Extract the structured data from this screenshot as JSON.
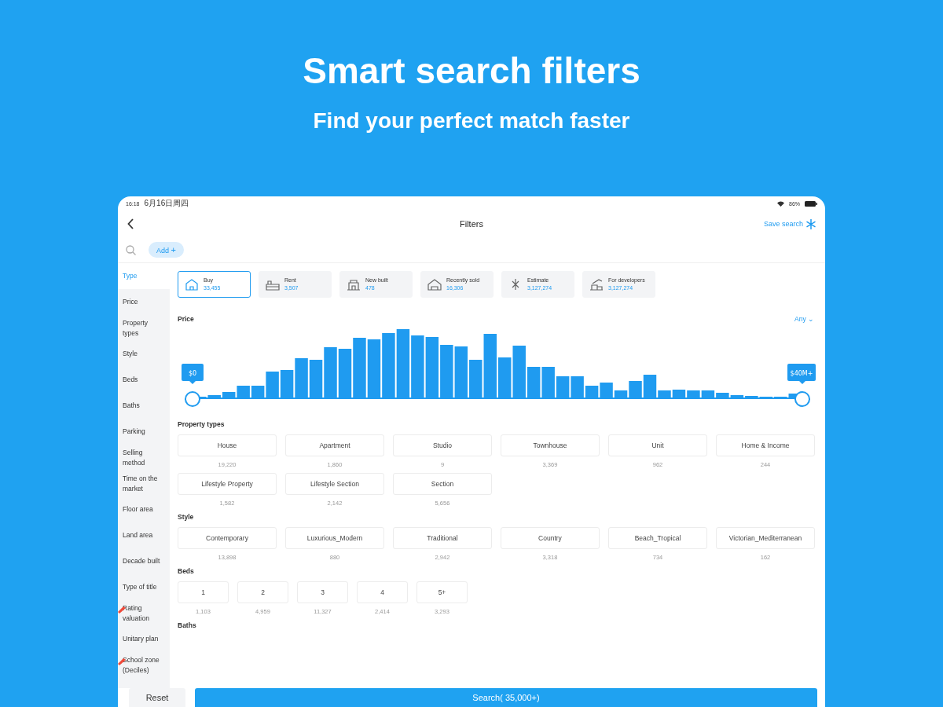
{
  "headline": "Smart search filters",
  "subheadline": "Find your perfect match faster",
  "status_bar": {
    "time": "16:18",
    "date": "6月16日周四",
    "battery": "86%"
  },
  "nav": {
    "title": "Filters",
    "save": "Save search"
  },
  "search": {
    "chip": "Add",
    "chip_icon": "+"
  },
  "sidebar": [
    {
      "label": "Type",
      "selected": true,
      "marked": false
    },
    {
      "label": "Price",
      "selected": false,
      "marked": false
    },
    {
      "label": "Property types",
      "selected": false,
      "marked": false
    },
    {
      "label": "Style",
      "selected": false,
      "marked": false
    },
    {
      "label": "Beds",
      "selected": false,
      "marked": false
    },
    {
      "label": "Baths",
      "selected": false,
      "marked": false
    },
    {
      "label": "Parking",
      "selected": false,
      "marked": false
    },
    {
      "label": "Selling method",
      "selected": false,
      "marked": false
    },
    {
      "label": "Time on the market",
      "selected": false,
      "marked": false
    },
    {
      "label": "Floor area",
      "selected": false,
      "marked": false
    },
    {
      "label": "Land area",
      "selected": false,
      "marked": false
    },
    {
      "label": "Decade built",
      "selected": false,
      "marked": false
    },
    {
      "label": "Type of title",
      "selected": false,
      "marked": false
    },
    {
      "label": "Rating valuation",
      "selected": false,
      "marked": true
    },
    {
      "label": "Unitary plan",
      "selected": false,
      "marked": false
    },
    {
      "label": "School zone (Deciles)",
      "selected": false,
      "marked": true
    }
  ],
  "types": [
    {
      "kind": "buy",
      "label": "Buy",
      "count": "33,455",
      "selected": true
    },
    {
      "kind": "rent",
      "label": "Rent",
      "count": "3,507",
      "selected": false
    },
    {
      "kind": "new",
      "label": "New built",
      "count": "478",
      "selected": false
    },
    {
      "kind": "sold",
      "label": "Recently sold",
      "count": "16,306",
      "selected": false
    },
    {
      "kind": "estimate",
      "label": "Estimate",
      "count": "3,127,274",
      "selected": false
    },
    {
      "kind": "developers",
      "label": "For developers",
      "count": "3,127,274",
      "selected": false
    }
  ],
  "price": {
    "label": "Price",
    "any": "Any",
    "any_icon": "⌄",
    "min": "$0",
    "max": "$40M+"
  },
  "sections": [
    {
      "title": "Property types",
      "kind": "wide",
      "options": [
        {
          "label": "House",
          "count": "19,220"
        },
        {
          "label": "Apartment",
          "count": "1,860"
        },
        {
          "label": "Studio",
          "count": "9"
        },
        {
          "label": "Townhouse",
          "count": "3,369"
        },
        {
          "label": "Unit",
          "count": "962"
        },
        {
          "label": "Home & Income",
          "count": "244"
        },
        {
          "label": "Lifestyle Property",
          "count": "1,582"
        },
        {
          "label": "Lifestyle Section",
          "count": "2,142"
        },
        {
          "label": "Section",
          "count": "5,656"
        }
      ]
    },
    {
      "title": "Style",
      "kind": "wide",
      "options": [
        {
          "label": "Contemporary",
          "count": "13,898"
        },
        {
          "label": "Luxurious_Modern",
          "count": "880"
        },
        {
          "label": "Traditional",
          "count": "2,942"
        },
        {
          "label": "Country",
          "count": "3,318"
        },
        {
          "label": "Beach_Tropical",
          "count": "734"
        },
        {
          "label": "Victorian_Mediterranean",
          "count": "162"
        }
      ]
    },
    {
      "title": "Beds",
      "kind": "narrow",
      "options": [
        {
          "label": "1",
          "count": "1,103"
        },
        {
          "label": "2",
          "count": "4,959"
        },
        {
          "label": "3",
          "count": "11,327"
        },
        {
          "label": "4",
          "count": "2,414"
        },
        {
          "label": "5+",
          "count": "3,293"
        }
      ]
    },
    {
      "title": "Baths"
    }
  ],
  "footer": {
    "reset": "Reset",
    "search": "Search( 35,000+)"
  }
}
